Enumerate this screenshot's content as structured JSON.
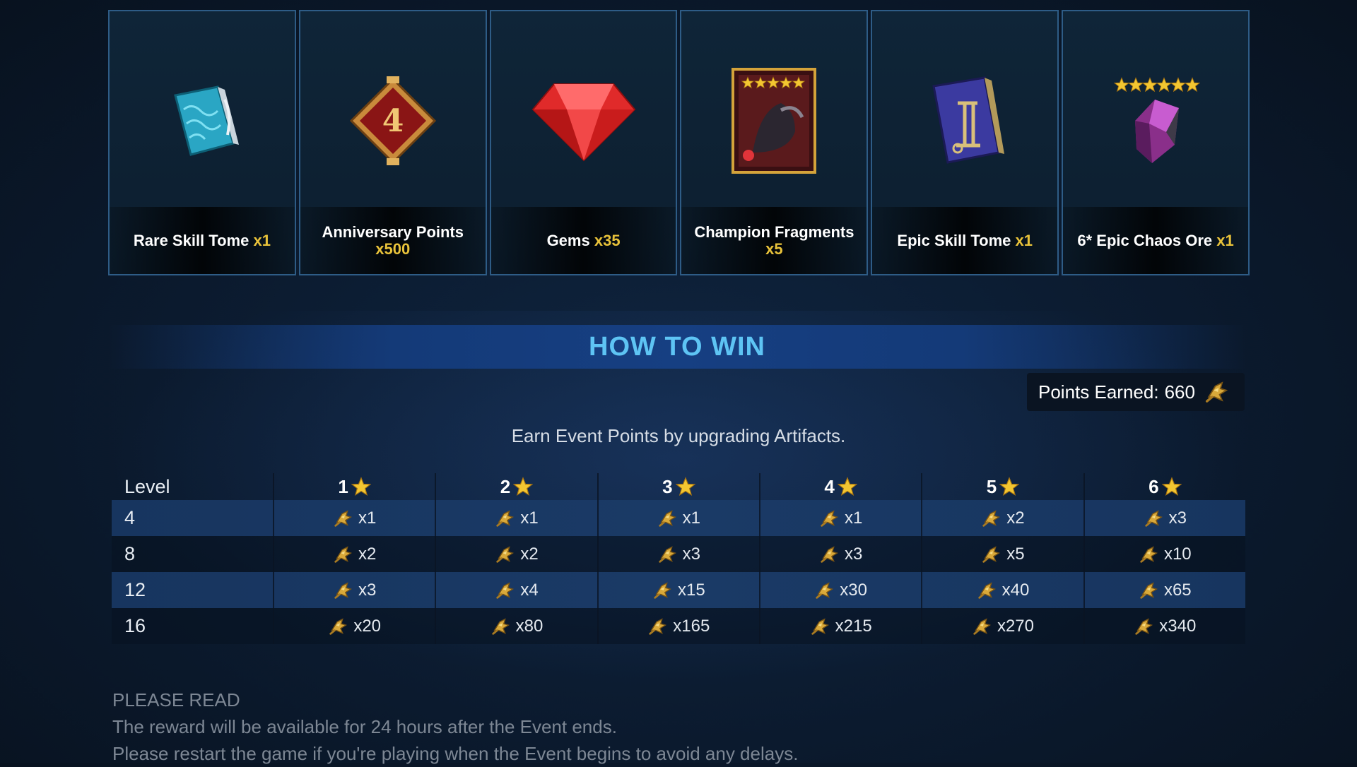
{
  "rewards": [
    {
      "name": "Rare Skill Tome",
      "qty": "x1",
      "icon": "blue-tome-icon"
    },
    {
      "name": "Anniversary Points",
      "qty": "x500",
      "icon": "anniversary-badge-icon"
    },
    {
      "name": "Gems",
      "qty": "x35",
      "icon": "red-gem-icon"
    },
    {
      "name": "Champion Fragments",
      "qty": "x5",
      "icon": "champion-card-icon"
    },
    {
      "name": "Epic Skill Tome",
      "qty": "x1",
      "icon": "purple-tome-icon"
    },
    {
      "name": "6* Epic Chaos Ore",
      "qty": "x1",
      "icon": "chaos-ore-icon"
    }
  ],
  "how_to_win": {
    "title": "HOW TO WIN",
    "points_label": "Points Earned:",
    "points_value": "660",
    "description": "Earn Event Points by upgrading Artifacts."
  },
  "table": {
    "level_header": "Level",
    "rank_headers": [
      "1",
      "2",
      "3",
      "4",
      "5",
      "6"
    ],
    "rows": [
      {
        "level": "4",
        "values": [
          "x1",
          "x1",
          "x1",
          "x1",
          "x2",
          "x3"
        ]
      },
      {
        "level": "8",
        "values": [
          "x2",
          "x2",
          "x3",
          "x3",
          "x5",
          "x10"
        ]
      },
      {
        "level": "12",
        "values": [
          "x3",
          "x4",
          "x15",
          "x30",
          "x40",
          "x65"
        ]
      },
      {
        "level": "16",
        "values": [
          "x20",
          "x80",
          "x165",
          "x215",
          "x270",
          "x340"
        ]
      }
    ]
  },
  "notes": {
    "heading": "PLEASE READ",
    "line1": "The reward will be available for 24 hours after the Event ends.",
    "line2": "Please restart the game if you're playing when the Event begins to avoid any delays."
  },
  "colors": {
    "accent_gold": "#e8c23a",
    "title_blue": "#5ec4f4",
    "card_border": "#2e5c86"
  }
}
